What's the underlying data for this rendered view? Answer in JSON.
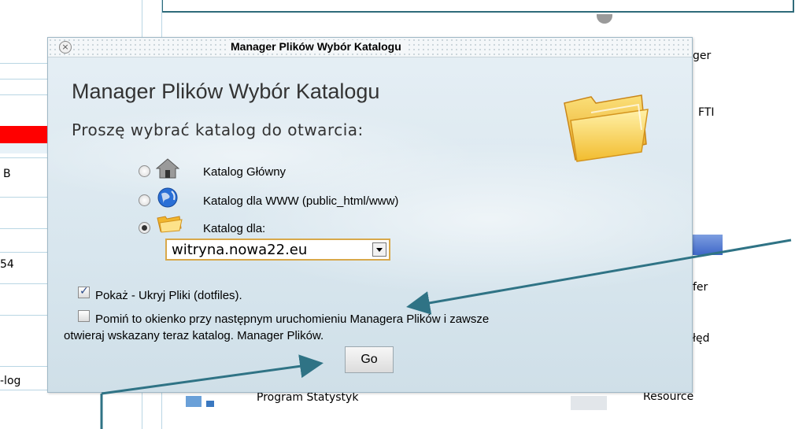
{
  "background": {
    "left_labels": [
      "B",
      "54",
      "-log"
    ],
    "right_labels": [
      "ger",
      "FTI",
      "fer",
      "łęd",
      "Resource"
    ],
    "bottom_label": "Program Statystyk"
  },
  "dialog": {
    "title": "Manager Plików Wybór Katalogu",
    "heading": "Manager Plików Wybór Katalogu",
    "subheading": "Proszę wybrać katalog do otwarcia:",
    "options": [
      {
        "label": "Katalog Główny",
        "icon": "home-icon",
        "checked": false
      },
      {
        "label": "Katalog dla WWW (public_html/www)",
        "icon": "globe-icon",
        "checked": false
      },
      {
        "label": "Katalog dla:",
        "icon": "folder-icon",
        "checked": true
      }
    ],
    "domain_select": {
      "value": "witryna.nowa22.eu"
    },
    "show_hidden": {
      "label": "Pokaż - Ukryj Pliki (dotfiles).",
      "checked": true
    },
    "skip_dialog": {
      "label_line1": "Pomiń to okienko przy następnym uruchomieniu Managera Plików i zawsze",
      "label_line2": "otwieraj wskazany teraz katalog. Manager Plików.",
      "checked": false
    },
    "go_label": "Go"
  },
  "colors": {
    "arrow": "#2f7385",
    "dialog_bg": "#dfeaf1",
    "select_border": "#d8a84a",
    "folder": "#f5c842"
  }
}
